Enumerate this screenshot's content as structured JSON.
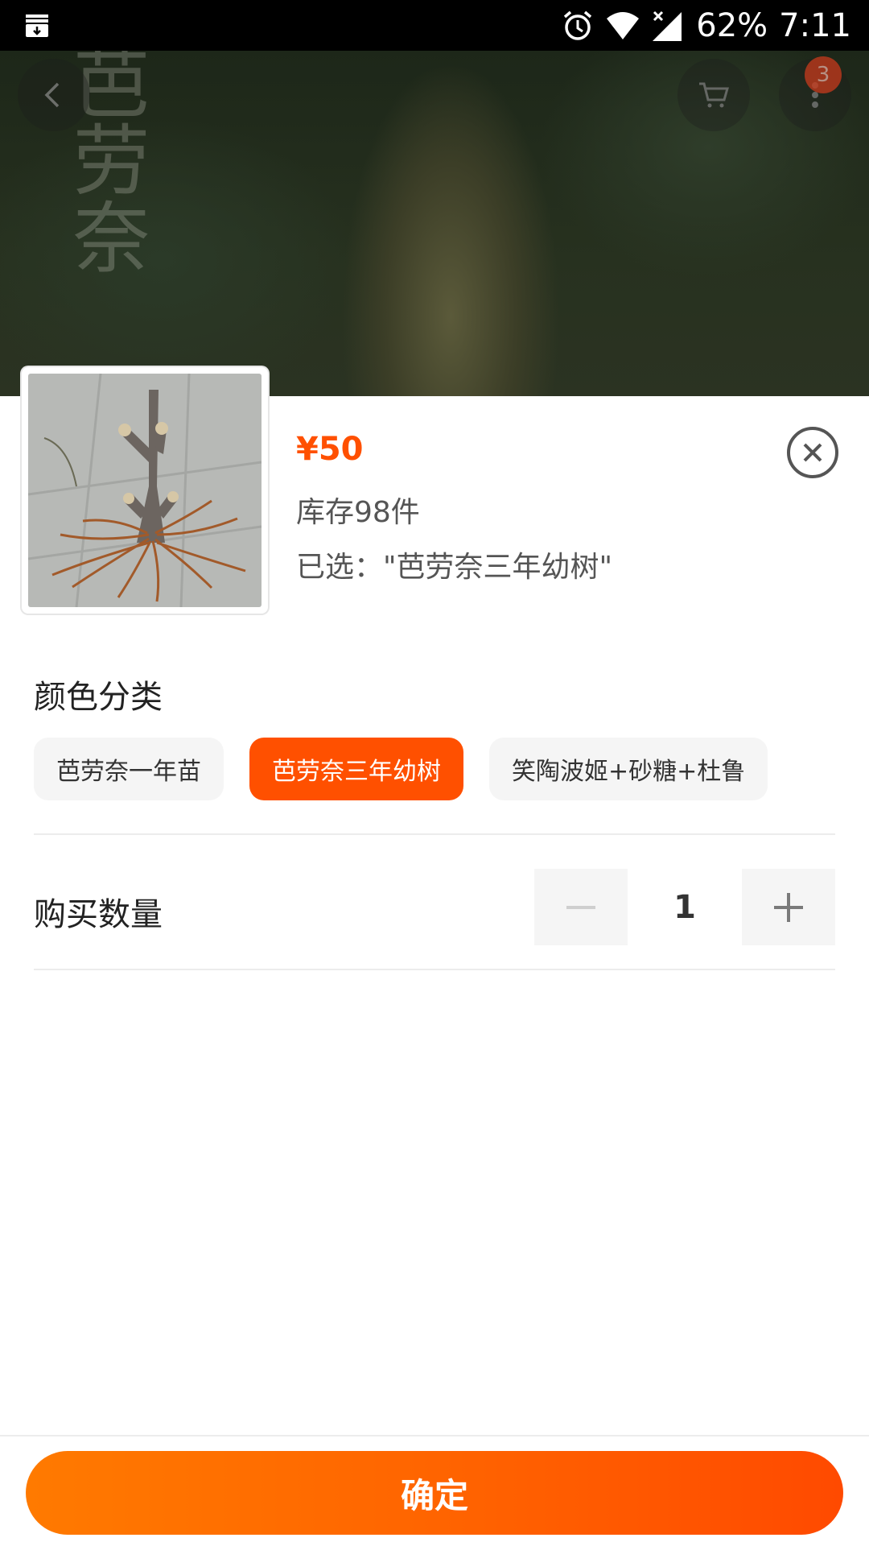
{
  "status_bar": {
    "battery": "62%",
    "time": "7:11",
    "icons": [
      "download-notification-icon",
      "alarm-icon",
      "wifi-icon",
      "signal-icon"
    ]
  },
  "header": {
    "watermark": "芭劳奈",
    "icons": [
      "back-icon",
      "cart-icon",
      "more-icon"
    ],
    "more_badge": "3"
  },
  "product": {
    "price": "¥50",
    "stock": "库存98件",
    "selected": "已选：\"芭劳奈三年幼树\""
  },
  "variants": {
    "title": "颜色分类",
    "options": [
      "芭劳奈一年苗",
      "芭劳奈三年幼树",
      "笑陶波姬+砂糖+杜鲁"
    ],
    "selected_index": 1
  },
  "quantity": {
    "title": "购买数量",
    "value": "1"
  },
  "confirm_label": "确定",
  "colors": {
    "accent": "#ff5000",
    "chip_bg": "#f5f5f5"
  }
}
